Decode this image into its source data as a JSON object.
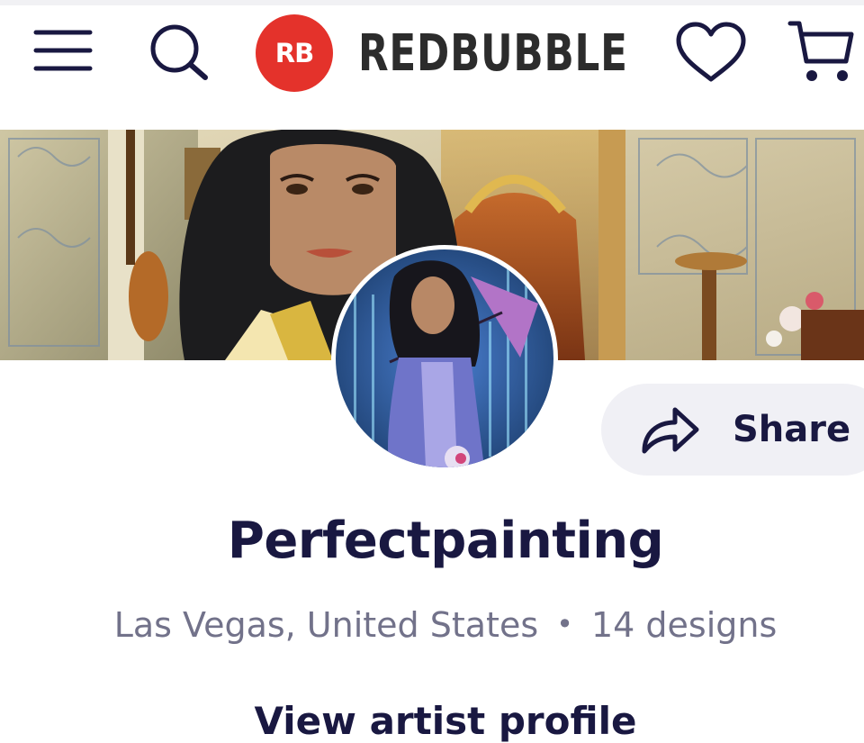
{
  "header": {
    "brand_mark": "RB",
    "brand_name": "REDBUBBLE",
    "icons": [
      "hamburger-menu-icon",
      "search-icon",
      "heart-icon",
      "cart-icon"
    ],
    "brand_color": "#e4322b"
  },
  "profile": {
    "artist_name": "Perfectpainting",
    "location": "Las Vegas, United States",
    "separator": "•",
    "designs_count": "14 designs",
    "share_label": "Share",
    "view_profile_label": "View artist profile"
  },
  "colors": {
    "text_primary": "#191841",
    "text_secondary": "#72728a",
    "share_bg": "#f0f0f5"
  }
}
